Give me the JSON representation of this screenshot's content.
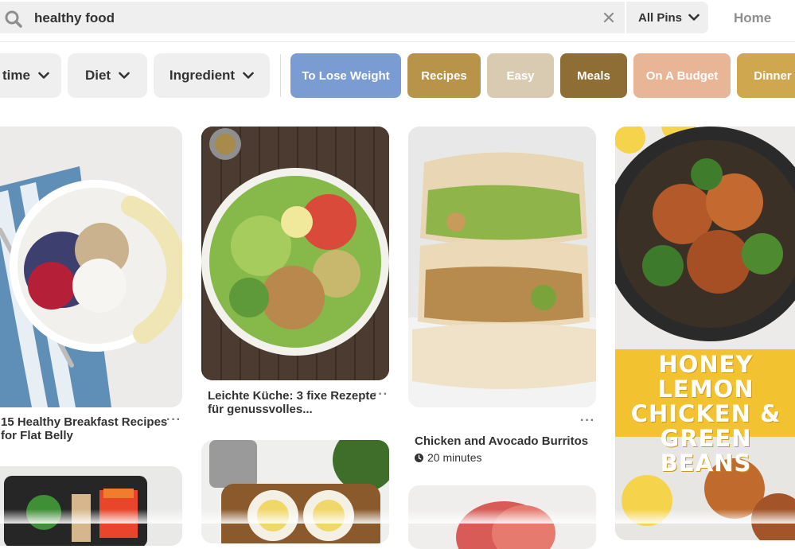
{
  "search": {
    "query": "healthy food",
    "scope_label": "All Pins",
    "home_label": "Home"
  },
  "filters": [
    "time",
    "Diet",
    "Ingredient"
  ],
  "chips": [
    {
      "label": "To Lose Weight",
      "color": "#7b9bd3"
    },
    {
      "label": "Recipes",
      "color": "#b8934a"
    },
    {
      "label": "Easy",
      "color": "#d9cbb1"
    },
    {
      "label": "Meals",
      "color": "#8f6e35"
    },
    {
      "label": "On A Budget",
      "color": "#e8b596"
    },
    {
      "label": "Dinner",
      "color": "#cfa74e"
    }
  ],
  "pins": [
    {
      "title_line1": "15 Healthy Breakfast Recipes",
      "title_line2": "for Flat Belly"
    },
    {
      "title_line1": "Leichte Küche: 3 fixe Rezepte",
      "title_line2": "für genussvolles..."
    },
    {
      "title_line1": "Chicken and Avocado Burritos",
      "meta": "20 minutes"
    },
    {
      "overlay_text": [
        "HONEY LEMON",
        "CHICKEN &",
        "GREEN BEANS"
      ]
    }
  ],
  "icons": {
    "search": "search-icon",
    "clear": "close-icon",
    "chevron": "chevron-down-icon",
    "clock": "clock-icon",
    "more": "more-icon"
  }
}
